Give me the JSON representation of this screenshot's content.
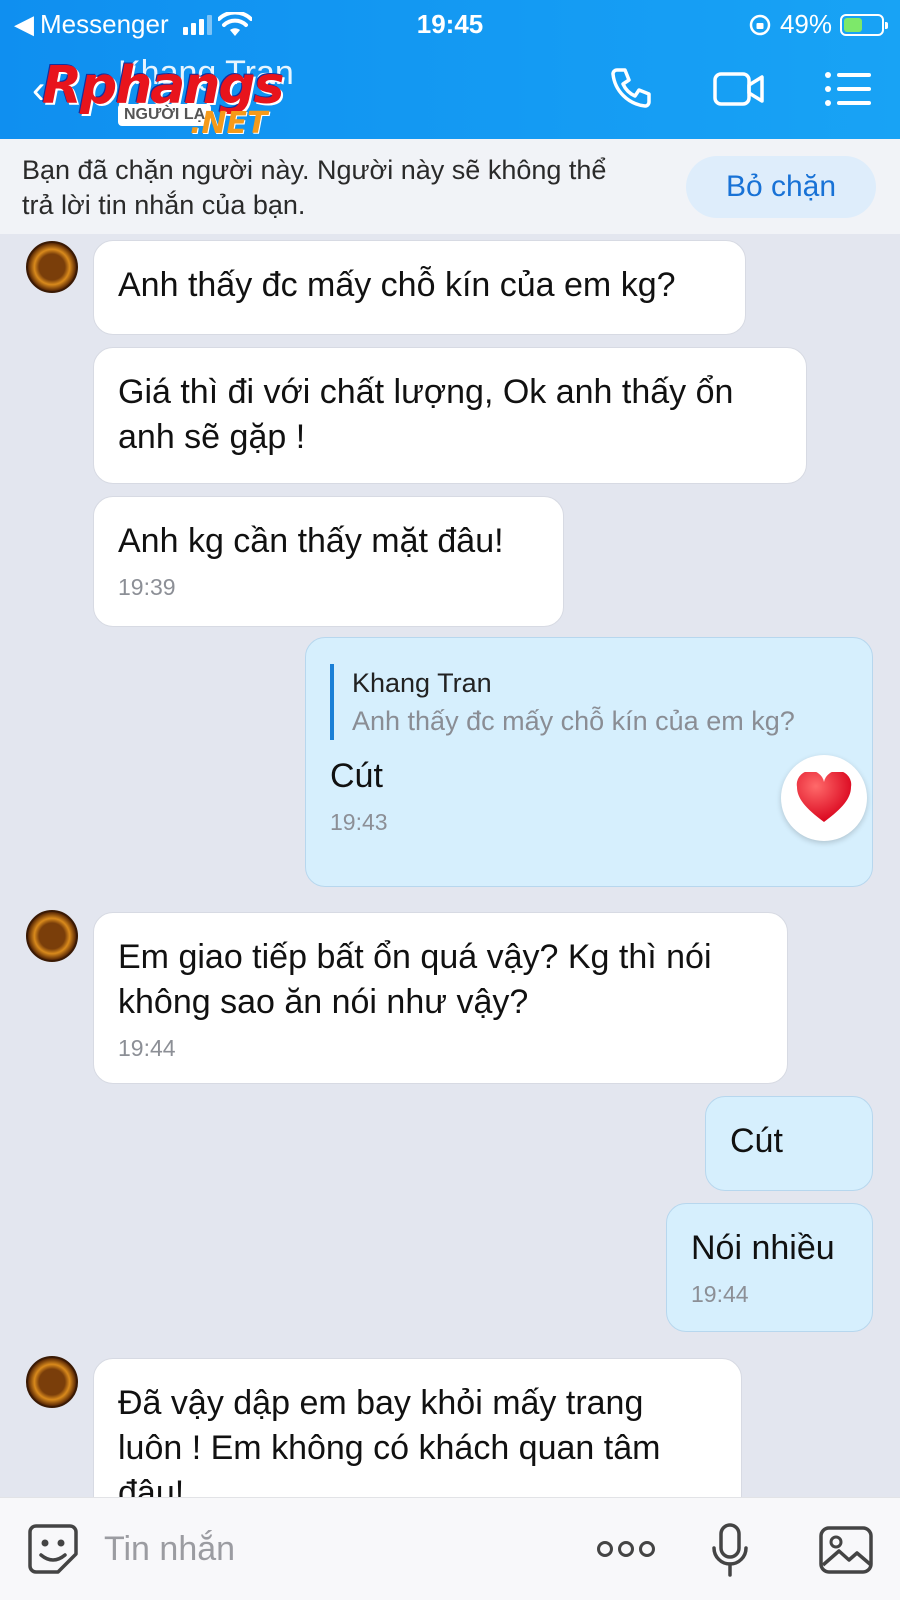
{
  "status_bar": {
    "back_app": "Messenger",
    "time": "19:45",
    "battery": "49%",
    "battery_level": 0.49
  },
  "header": {
    "contact_name": "Khang Tran",
    "badge": "NGƯỜI LẠ",
    "watermark_line1": "Rphangs",
    "watermark_line2": ".NET"
  },
  "banner": {
    "text": "Bạn đã chặn người này. Người này sẽ không thể trả lời tin nhắn của bạn.",
    "button": "Bỏ chặn"
  },
  "messages": {
    "m1": {
      "text": "Anh thấy đc mấy chỗ kín của em kg?"
    },
    "m2": {
      "text": "Giá thì đi với chất lượng, Ok anh thấy ổn anh sẽ gặp !"
    },
    "m3": {
      "text": "Anh kg cần thấy mặt đâu!",
      "time": "19:39"
    },
    "m4": {
      "reply_name": "Khang Tran",
      "reply_text": "Anh thấy đc mấy chỗ kín của em kg?",
      "text": "Cút",
      "time": "19:43",
      "reaction": "heart-icon"
    },
    "m5": {
      "text": "Em giao tiếp bất ổn quá vậy? Kg thì nói không sao ăn nói như vậy?",
      "time": "19:44"
    },
    "m6": {
      "text": "Cút"
    },
    "m7": {
      "text": "Nói nhiều",
      "time": "19:44"
    },
    "m8": {
      "text": "Đã vậy dập em bay khỏi mấy trang luôn ! Em không có khách quan tâm đâu!"
    }
  },
  "composer": {
    "placeholder": "Tin nhắn"
  },
  "colors": {
    "header": "#1499f2",
    "outgoing_bubble": "#d6effd",
    "incoming_bubble": "#ffffff",
    "accent": "#1872d6"
  }
}
